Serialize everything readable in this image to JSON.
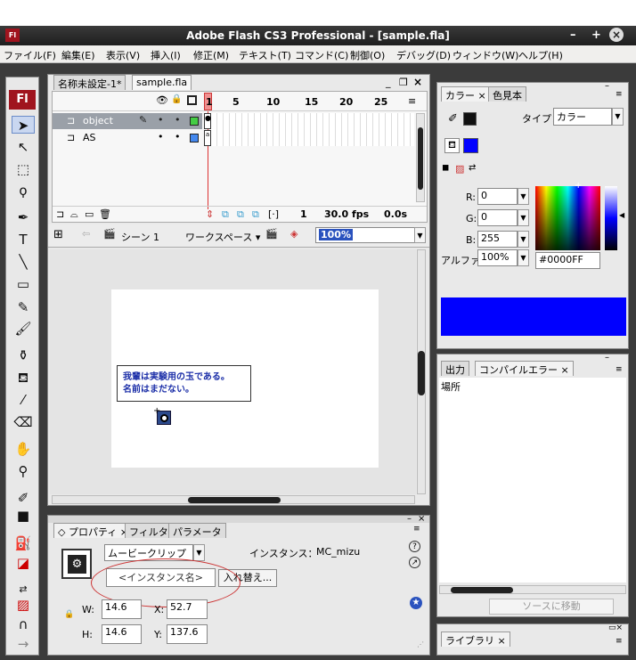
{
  "app": {
    "title": "Adobe Flash CS3 Professional - [sample.fla]",
    "logo": "Fl",
    "window_controls": [
      "–",
      "+",
      "×"
    ]
  },
  "menu": [
    "ファイル(F)",
    "編集(E)",
    "表示(V)",
    "挿入(I)",
    "修正(M)",
    "テキスト(T)",
    "コマンド(C)",
    "制御(O)",
    "デバッグ(D)",
    "ウィンドウ(W)",
    "ヘルプ(H)"
  ],
  "doc_tabs": [
    "名称未設定-1*",
    "sample.fla"
  ],
  "timeline": {
    "layers": [
      {
        "name": "object",
        "color": "#44cc44"
      },
      {
        "name": "AS",
        "color": "#4488ee"
      }
    ],
    "frame_numbers": [
      "1",
      "5",
      "10",
      "15",
      "20",
      "25"
    ],
    "current_frame": "1",
    "fps": "30.0 fps",
    "time": "0.0s",
    "tab_menu": "≡"
  },
  "stagebar": {
    "scene": "シーン 1",
    "workspace": "ワークスペース ▾",
    "zoom": "100%"
  },
  "stage_text": {
    "line1": "我輩は実験用の玉である。",
    "line2": "名前はまだない。"
  },
  "properties": {
    "tabs": [
      "プロパティ ×",
      "フィルタ",
      "パラメータ"
    ],
    "symbol_type": "ムービークリップ",
    "instance_label": "インスタンス：",
    "instance_of": "MC_mizu",
    "instance_name_placeholder": "<インスタンス名>",
    "swap_button": "入れ替え...",
    "w_label": "W:",
    "w": "14.6",
    "h_label": "H:",
    "h": "14.6",
    "x_label": "X:",
    "x": "52.7",
    "y_label": "Y:",
    "y": "137.6"
  },
  "color_panel": {
    "tabs": [
      "カラー ×",
      "色見本"
    ],
    "type_label": "タイプ：",
    "type_value": "カラー",
    "r_label": "R:",
    "r": "0",
    "g_label": "G:",
    "g": "0",
    "b_label": "B:",
    "b": "255",
    "alpha_label": "アルファ:",
    "alpha": "100%",
    "hex": "#0000FF",
    "swatch_color": "#0000FF"
  },
  "output_panel": {
    "tabs": [
      "出力",
      "コンパイルエラー ×"
    ],
    "column_header": "場所",
    "goto_source_button": "ソースに移動"
  },
  "library_panel": {
    "tab": "ライブラリ ×"
  }
}
